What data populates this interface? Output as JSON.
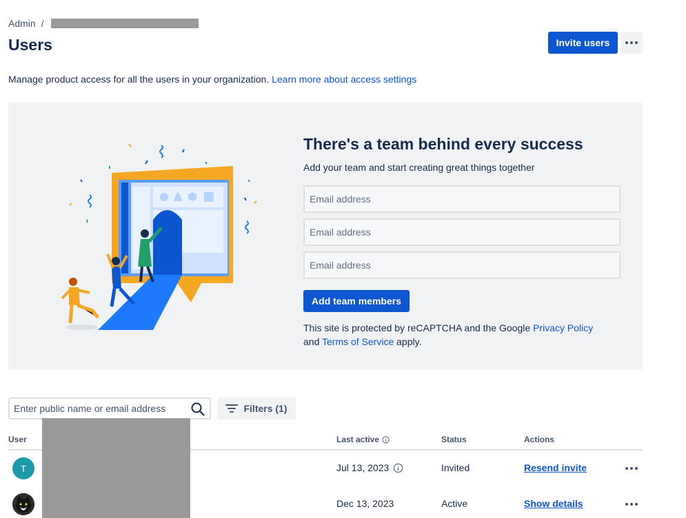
{
  "breadcrumb": {
    "root": "Admin",
    "separator": "/"
  },
  "page": {
    "title": "Users",
    "description": "Manage product access for all the users in your organization.",
    "learn_more": "Learn more about access settings"
  },
  "header_actions": {
    "invite_label": "Invite users"
  },
  "invite_panel": {
    "title": "There's a team behind every success",
    "subtitle": "Add your team and start creating great things together",
    "email_placeholder": "Email address",
    "add_label": "Add team members",
    "legal_prefix": "This site is protected by reCAPTCHA and the Google",
    "privacy_link": "Privacy Policy",
    "legal_and": "and",
    "terms_link": "Terms of Service",
    "legal_suffix": "apply."
  },
  "search": {
    "placeholder": "Enter public name or email address"
  },
  "filters": {
    "label": "Filters (1)"
  },
  "table": {
    "columns": {
      "user": "User",
      "last_active": "Last active",
      "status": "Status",
      "actions": "Actions"
    },
    "rows": [
      {
        "avatar_initial": "T",
        "last_active": "Jul 13, 2023",
        "status": "Invited",
        "action": "Resend invite"
      },
      {
        "avatar_initial": "",
        "last_active": "Dec 13, 2023",
        "status": "Active",
        "action": "Show details"
      }
    ]
  },
  "colors": {
    "brand": "#0c57d0",
    "panel_bg": "#f1f2f4",
    "text": "#172b4d",
    "subtle": "#44546f"
  }
}
